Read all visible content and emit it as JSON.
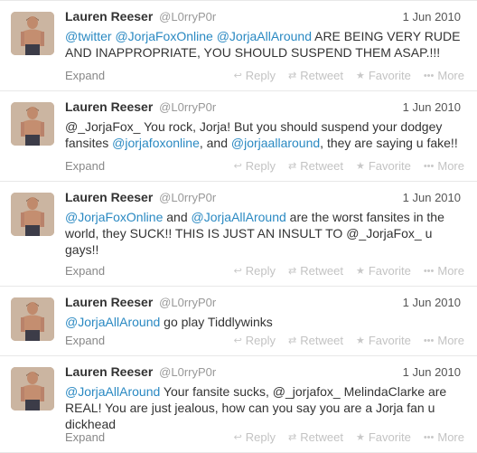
{
  "tweets": [
    {
      "name": "Lauren Reeser",
      "handle": "@L0rryP0r",
      "time": "1 Jun 2010",
      "segments": [
        {
          "t": "@twitter",
          "m": true
        },
        {
          "t": " ",
          "m": false
        },
        {
          "t": "@JorjaFoxOnline",
          "m": true
        },
        {
          "t": " ",
          "m": false
        },
        {
          "t": "@JorjaAllAround",
          "m": true
        },
        {
          "t": " ARE BEING VERY RUDE AND INAPPROPRIATE, YOU SHOULD SUSPEND THEM ASAP.!!!",
          "m": false
        }
      ]
    },
    {
      "name": "Lauren Reeser",
      "handle": "@L0rryP0r",
      "time": "1 Jun 2010",
      "segments": [
        {
          "t": "@_JorjaFox_ You rock, Jorja! But you should suspend your dodgey fansites ",
          "m": false
        },
        {
          "t": "@jorjafoxonline",
          "m": true
        },
        {
          "t": ", and ",
          "m": false
        },
        {
          "t": "@jorjaallaround",
          "m": true
        },
        {
          "t": ", they are saying u fake!!",
          "m": false
        }
      ]
    },
    {
      "name": "Lauren Reeser",
      "handle": "@L0rryP0r",
      "time": "1 Jun 2010",
      "segments": [
        {
          "t": "@JorjaFoxOnline",
          "m": true
        },
        {
          "t": " and ",
          "m": false
        },
        {
          "t": "@JorjaAllAround",
          "m": true
        },
        {
          "t": " are the worst fansites in the world, they SUCK!! THIS IS JUST AN INSULT TO @_JorjaFox_ u gays!!",
          "m": false
        }
      ]
    },
    {
      "name": "Lauren Reeser",
      "handle": "@L0rryP0r",
      "time": "1 Jun 2010",
      "segments": [
        {
          "t": "@JorjaAllAround",
          "m": true
        },
        {
          "t": " go play Tiddlywinks",
          "m": false
        }
      ]
    },
    {
      "name": "Lauren Reeser",
      "handle": "@L0rryP0r",
      "time": "1 Jun 2010",
      "segments": [
        {
          "t": "@JorjaAllAround",
          "m": true
        },
        {
          "t": " Your fansite sucks, @_jorjafox_ MelindaClarke are REAL! You are just jealous, how can you say you are a Jorja fan u dickhead",
          "m": false
        }
      ]
    }
  ],
  "labels": {
    "expand": "Expand",
    "reply": "Reply",
    "retweet": "Retweet",
    "favorite": "Favorite",
    "more": "More"
  },
  "icons": {
    "reply": "reply-arrow-icon",
    "retweet": "retweet-icon",
    "favorite": "star-icon",
    "more": "more-dots-icon"
  },
  "colors": {
    "mention": "#2a89c2",
    "name": "#333333",
    "muted": "#999999"
  }
}
